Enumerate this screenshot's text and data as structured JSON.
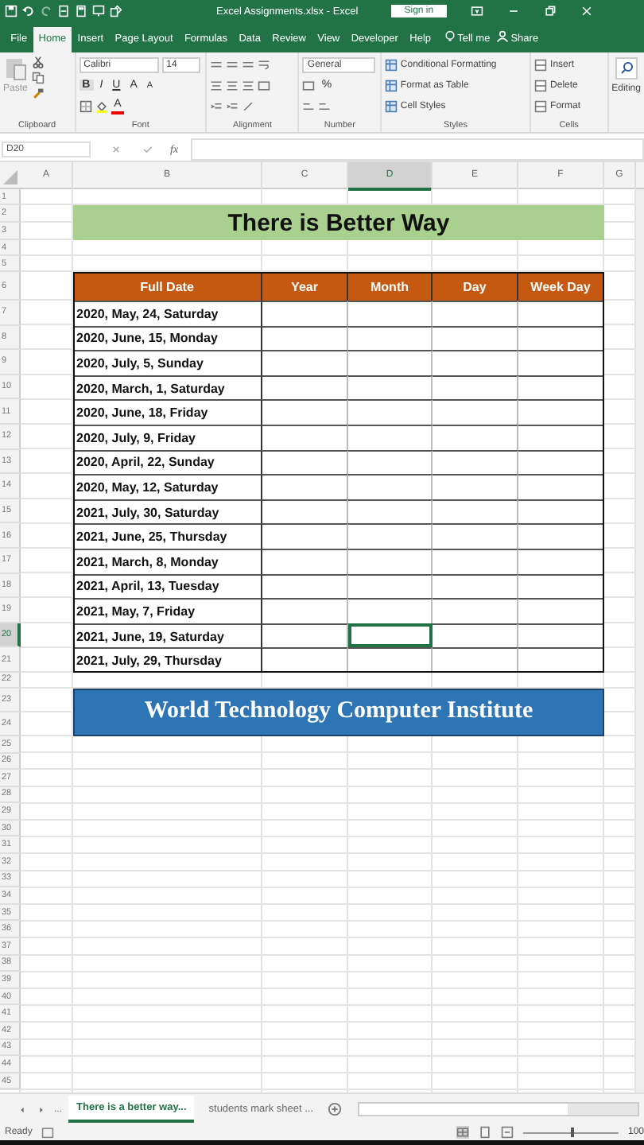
{
  "window": {
    "title": "Excel Assignments.xlsx  -  Excel",
    "sign_in": "Sign in"
  },
  "ribbon_tabs": [
    {
      "label": "File",
      "selected": false
    },
    {
      "label": "Home",
      "selected": true
    },
    {
      "label": "Insert",
      "selected": false
    },
    {
      "label": "Page Layout",
      "selected": false
    },
    {
      "label": "Formulas",
      "selected": false
    },
    {
      "label": "Data",
      "selected": false
    },
    {
      "label": "Review",
      "selected": false
    },
    {
      "label": "View",
      "selected": false
    },
    {
      "label": "Developer",
      "selected": false
    },
    {
      "label": "Help",
      "selected": false
    }
  ],
  "tell_me": "Tell me",
  "share": "Share",
  "ribbon": {
    "paste": "Paste",
    "font_name": "Calibri",
    "font_size": "14",
    "bold": "B",
    "italic": "I",
    "underline": "U",
    "grow_font": "A",
    "shrink_font": "A",
    "font_color": "A",
    "number_format": "General",
    "percent": "%",
    "styles": [
      "Conditional Formatting",
      "Format as Table",
      "Cell Styles"
    ],
    "cells": [
      "Insert",
      "Delete",
      "Format"
    ],
    "editing": "Editing",
    "groups": [
      "Clipboard",
      "Font",
      "Alignment",
      "Number",
      "Styles",
      "Cells"
    ]
  },
  "name_box": "D20",
  "fx": "fx",
  "column_headers": [
    {
      "label": "A",
      "selected": false
    },
    {
      "label": "B",
      "selected": false
    },
    {
      "label": "C",
      "selected": false
    },
    {
      "label": "D",
      "selected": true
    },
    {
      "label": "E",
      "selected": false
    },
    {
      "label": "F",
      "selected": false
    },
    {
      "label": "G",
      "selected": false
    }
  ],
  "row_numbers": [
    {
      "label": "1",
      "selected": false
    },
    {
      "label": "2",
      "selected": false
    },
    {
      "label": "3",
      "selected": false
    },
    {
      "label": "4",
      "selected": false
    },
    {
      "label": "5",
      "selected": false
    },
    {
      "label": "6",
      "selected": false
    },
    {
      "label": "7",
      "selected": false
    },
    {
      "label": "8",
      "selected": false
    },
    {
      "label": "9",
      "selected": false
    },
    {
      "label": "10",
      "selected": false
    },
    {
      "label": "11",
      "selected": false
    },
    {
      "label": "12",
      "selected": false
    },
    {
      "label": "13",
      "selected": false
    },
    {
      "label": "14",
      "selected": false
    },
    {
      "label": "15",
      "selected": false
    },
    {
      "label": "16",
      "selected": false
    },
    {
      "label": "17",
      "selected": false
    },
    {
      "label": "18",
      "selected": false
    },
    {
      "label": "19",
      "selected": false
    },
    {
      "label": "20",
      "selected": true
    },
    {
      "label": "21",
      "selected": false
    },
    {
      "label": "22",
      "selected": false
    },
    {
      "label": "23",
      "selected": false
    },
    {
      "label": "24",
      "selected": false
    },
    {
      "label": "25",
      "selected": false
    },
    {
      "label": "26",
      "selected": false
    },
    {
      "label": "27",
      "selected": false
    },
    {
      "label": "28",
      "selected": false
    },
    {
      "label": "29",
      "selected": false
    },
    {
      "label": "30",
      "selected": false
    },
    {
      "label": "31",
      "selected": false
    },
    {
      "label": "32",
      "selected": false
    },
    {
      "label": "33",
      "selected": false
    },
    {
      "label": "34",
      "selected": false
    },
    {
      "label": "35",
      "selected": false
    },
    {
      "label": "36",
      "selected": false
    },
    {
      "label": "37",
      "selected": false
    },
    {
      "label": "38",
      "selected": false
    },
    {
      "label": "39",
      "selected": false
    },
    {
      "label": "40",
      "selected": false
    },
    {
      "label": "41",
      "selected": false
    },
    {
      "label": "42",
      "selected": false
    },
    {
      "label": "43",
      "selected": false
    },
    {
      "label": "44",
      "selected": false
    },
    {
      "label": "45",
      "selected": false
    }
  ],
  "sheet": {
    "title": "There is Better Way",
    "table_columns": [
      "Full Date",
      "Year",
      "Month",
      "Day",
      "Week Day"
    ],
    "rows": [
      "2020, May, 24, Saturday",
      "2020, June, 15, Monday",
      "2020, July, 5, Sunday",
      "2020, March, 1, Saturday",
      "2020, June, 18, Friday",
      "2020, July, 9, Friday",
      "2020, April, 22, Sunday",
      "2020, May, 12, Saturday",
      "2021, July, 30, Saturday",
      "2021, June, 25, Thursday",
      "2021, March, 8, Monday",
      "2021, April, 13, Tuesday",
      "2021, May, 7, Friday",
      "2021, June, 19, Saturday",
      "2021, July, 29, Thursday"
    ],
    "banner": "World Technology Computer Institute"
  },
  "sheet_tabs": {
    "more": "...",
    "tabs": [
      {
        "label": "There is a better way...",
        "selected": true
      },
      {
        "label": "students mark sheet ...",
        "selected": false
      }
    ]
  },
  "status_bar": {
    "status": "Ready",
    "zoom": {
      "level": 0.5,
      "reading": "100"
    }
  }
}
